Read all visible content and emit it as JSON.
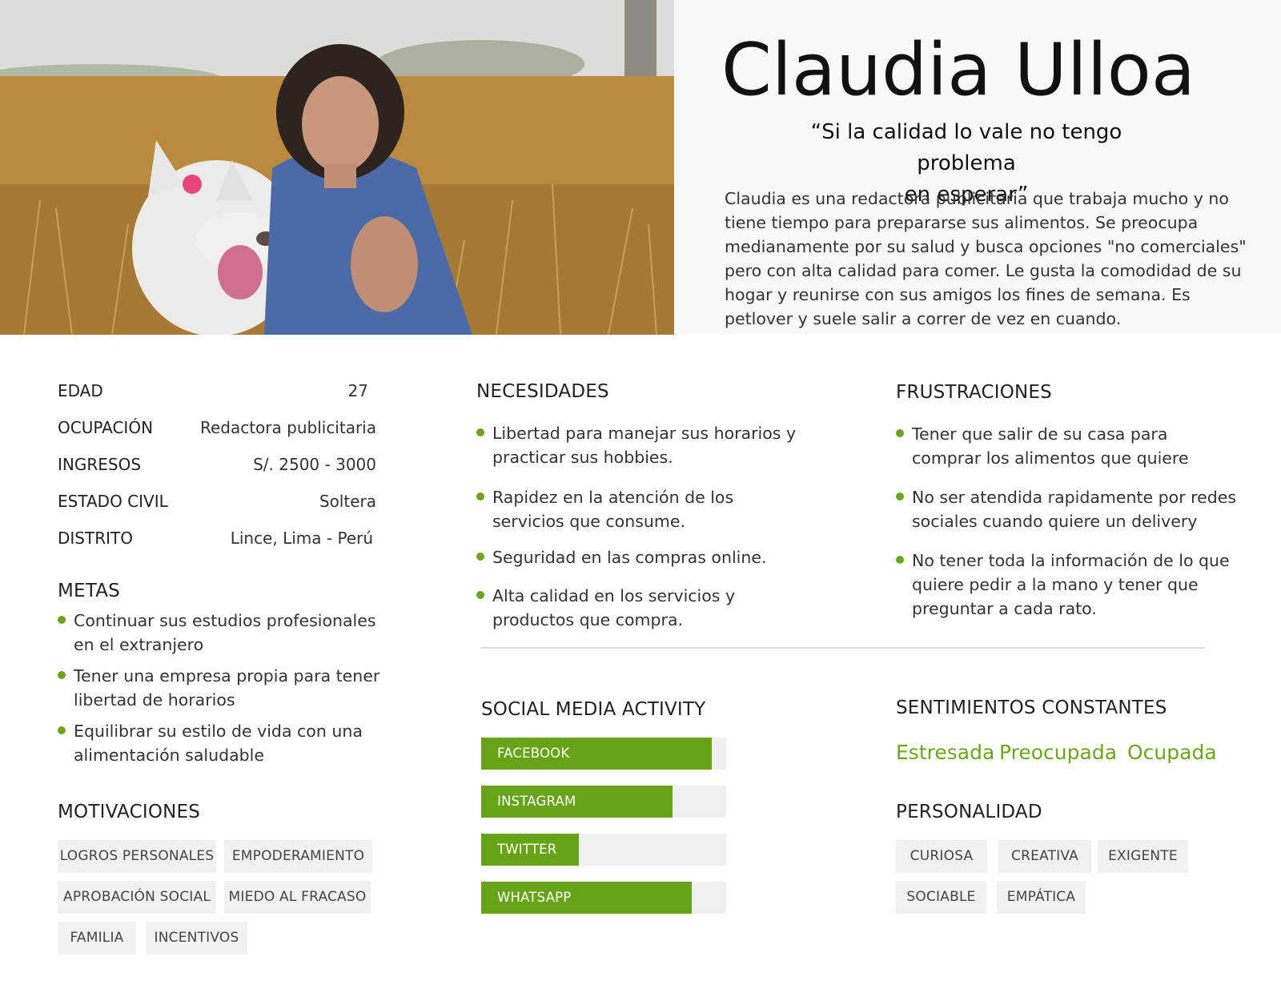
{
  "hero": {
    "name": "Claudia Ulloa",
    "quote_line1": "“Si la calidad lo vale no tengo problema",
    "quote_line2": "en esperar”",
    "description": "Claudia es una redactora publicitaria que trabaja mucho y no tiene tiempo para prepararse sus alimentos. Se preocupa medianamente por su salud y busca opciones \"no comerciales\" pero con alta calidad para comer. Le gusta la comodidad de su hogar y reunirse con sus amigos los fines de semana. Es petlover y suele salir a correr de vez en cuando."
  },
  "profile": [
    {
      "label": "EDAD",
      "value": "27"
    },
    {
      "label": "OCUPACIÓN",
      "value": "Redactora publicitaria"
    },
    {
      "label": "INGRESOS",
      "value": "S/. 2500 - 3000"
    },
    {
      "label": "ESTADO CIVIL",
      "value": "Soltera"
    },
    {
      "label": "DISTRITO",
      "value": "Lince, Lima - Perú"
    }
  ],
  "metas": {
    "title": "METAS",
    "items": [
      {
        "l1": "Continuar sus estudios profesionales",
        "l2": "en el extranjero"
      },
      {
        "l1": "Tener una empresa propia para tener",
        "l2": "libertad de horarios"
      },
      {
        "l1": "Equilibrar su estilo de vida con una",
        "l2": "alimentación saludable"
      }
    ]
  },
  "motivaciones": {
    "title": "MOTIVACIONES",
    "tags": [
      "LOGROS PERSONALES",
      "EMPODERAMIENTO",
      "APROBACIÓN SOCIAL",
      "MIEDO AL FRACASO",
      "FAMILIA",
      "INCENTIVOS"
    ]
  },
  "necesidades": {
    "title": "NECESIDADES",
    "items": [
      {
        "l1": "Libertad para manejar sus horarios y",
        "l2": "practicar sus hobbies."
      },
      {
        "l1": "Rapidez en la atención de los",
        "l2": "servicios que consume."
      },
      {
        "l1": "Seguridad en las compras online.",
        "l2": ""
      },
      {
        "l1": "Alta calidad en los servicios y",
        "l2": "productos que compra."
      }
    ]
  },
  "frustraciones": {
    "title": "FRUSTRACIONES",
    "items": [
      {
        "l1": "Tener que salir de su casa para",
        "l2": "comprar los alimentos que quiere",
        "l3": ""
      },
      {
        "l1": "No ser atendida rapidamente por redes",
        "l2": "sociales cuando quiere un delivery",
        "l3": ""
      },
      {
        "l1": "No tener toda la información de lo que",
        "l2": "quiere pedir a la mano y tener que",
        "l3": "preguntar a cada rato."
      }
    ]
  },
  "social": {
    "title": "SOCIAL MEDIA ACTIVITY",
    "bars": [
      {
        "label": "FACEBOOK",
        "level": 0.94
      },
      {
        "label": "INSTAGRAM",
        "level": 0.78
      },
      {
        "label": "TWITTER",
        "level": 0.4
      },
      {
        "label": "WHATSAPP",
        "level": 0.86
      }
    ],
    "bar_color": "#67a316"
  },
  "sentimientos": {
    "title": "SENTIMIENTOS CONSTANTES",
    "items": [
      "Estresada",
      "Preocupada",
      "Ocupada"
    ],
    "color": "#6aa51e"
  },
  "personalidad": {
    "title": "PERSONALIDAD",
    "tags": [
      "CURIOSA",
      "CREATIVA",
      "EXIGENTE",
      "SOCIABLE",
      "EMPÁTICA"
    ]
  }
}
